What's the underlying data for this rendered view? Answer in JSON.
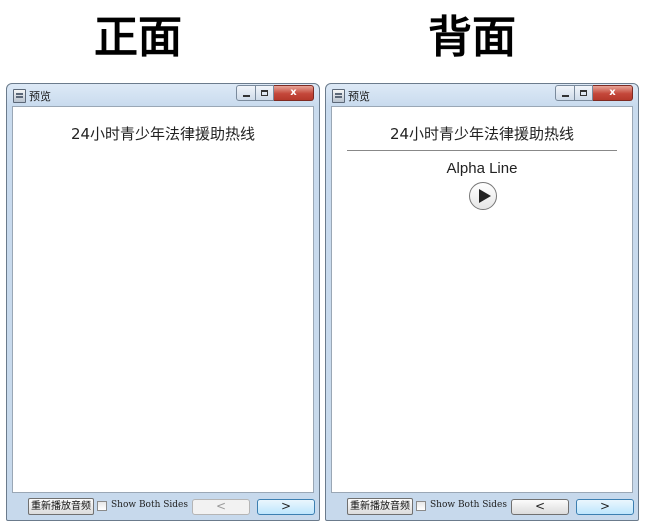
{
  "captions": {
    "front": "正面",
    "back": "背面"
  },
  "window_title": "预览",
  "card": {
    "question": "24小时青少年法律援助热线",
    "answer": "Alpha Line"
  },
  "controls": {
    "replay_label": "重新播放音频",
    "show_both_label": "Show Both Sides",
    "show_both_checked": false,
    "prev_label": "<",
    "next_label": ">",
    "close_label": "x"
  },
  "icons": {
    "app": "window-app-icon",
    "minimize": "minimize-icon",
    "maximize": "maximize-icon",
    "close": "close-icon",
    "play": "play-audio-icon"
  },
  "colors": {
    "window_frame": "#c7d9ec",
    "close_button": "#c4473a",
    "focused_button": "#bee6fd"
  }
}
